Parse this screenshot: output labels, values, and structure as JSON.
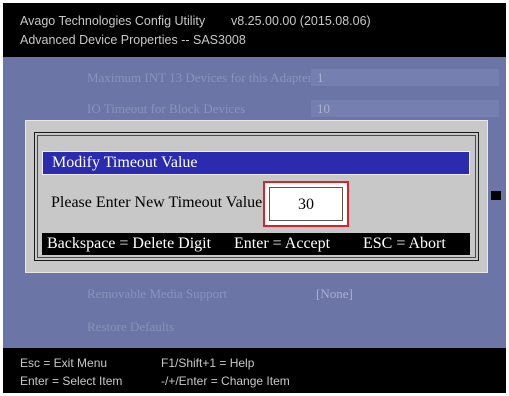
{
  "header": {
    "app_title": "Avago Technologies Config Utility",
    "version": "v8.25.00.00  (2015.08.06)",
    "page_title": "Advanced Device Properties -- SAS3008"
  },
  "options": [
    {
      "label": "Maximum INT 13 Devices for this Adapter",
      "value": "1"
    },
    {
      "label": "IO Timeout for Block Devices",
      "value": "10"
    },
    {
      "label": "Removable Media Support",
      "value": "[None]"
    },
    {
      "label": "Restore Defaults",
      "value": ""
    }
  ],
  "dialog": {
    "title": "Modify Timeout Value",
    "prompt": "Please Enter New Timeout Value",
    "input_value": "30",
    "help": {
      "backspace": "Backspace = Delete Digit",
      "enter": "Enter = Accept",
      "esc": "ESC = Abort"
    }
  },
  "footer": {
    "esc": "Esc = Exit Menu",
    "enter": "Enter = Select Item",
    "f1": "F1/Shift+1 = Help",
    "change": "-/+/Enter = Change Item"
  },
  "colors": {
    "background": "#6c76a6",
    "title_bar": "#2b2bb0",
    "highlight_border": "#d9232b"
  }
}
